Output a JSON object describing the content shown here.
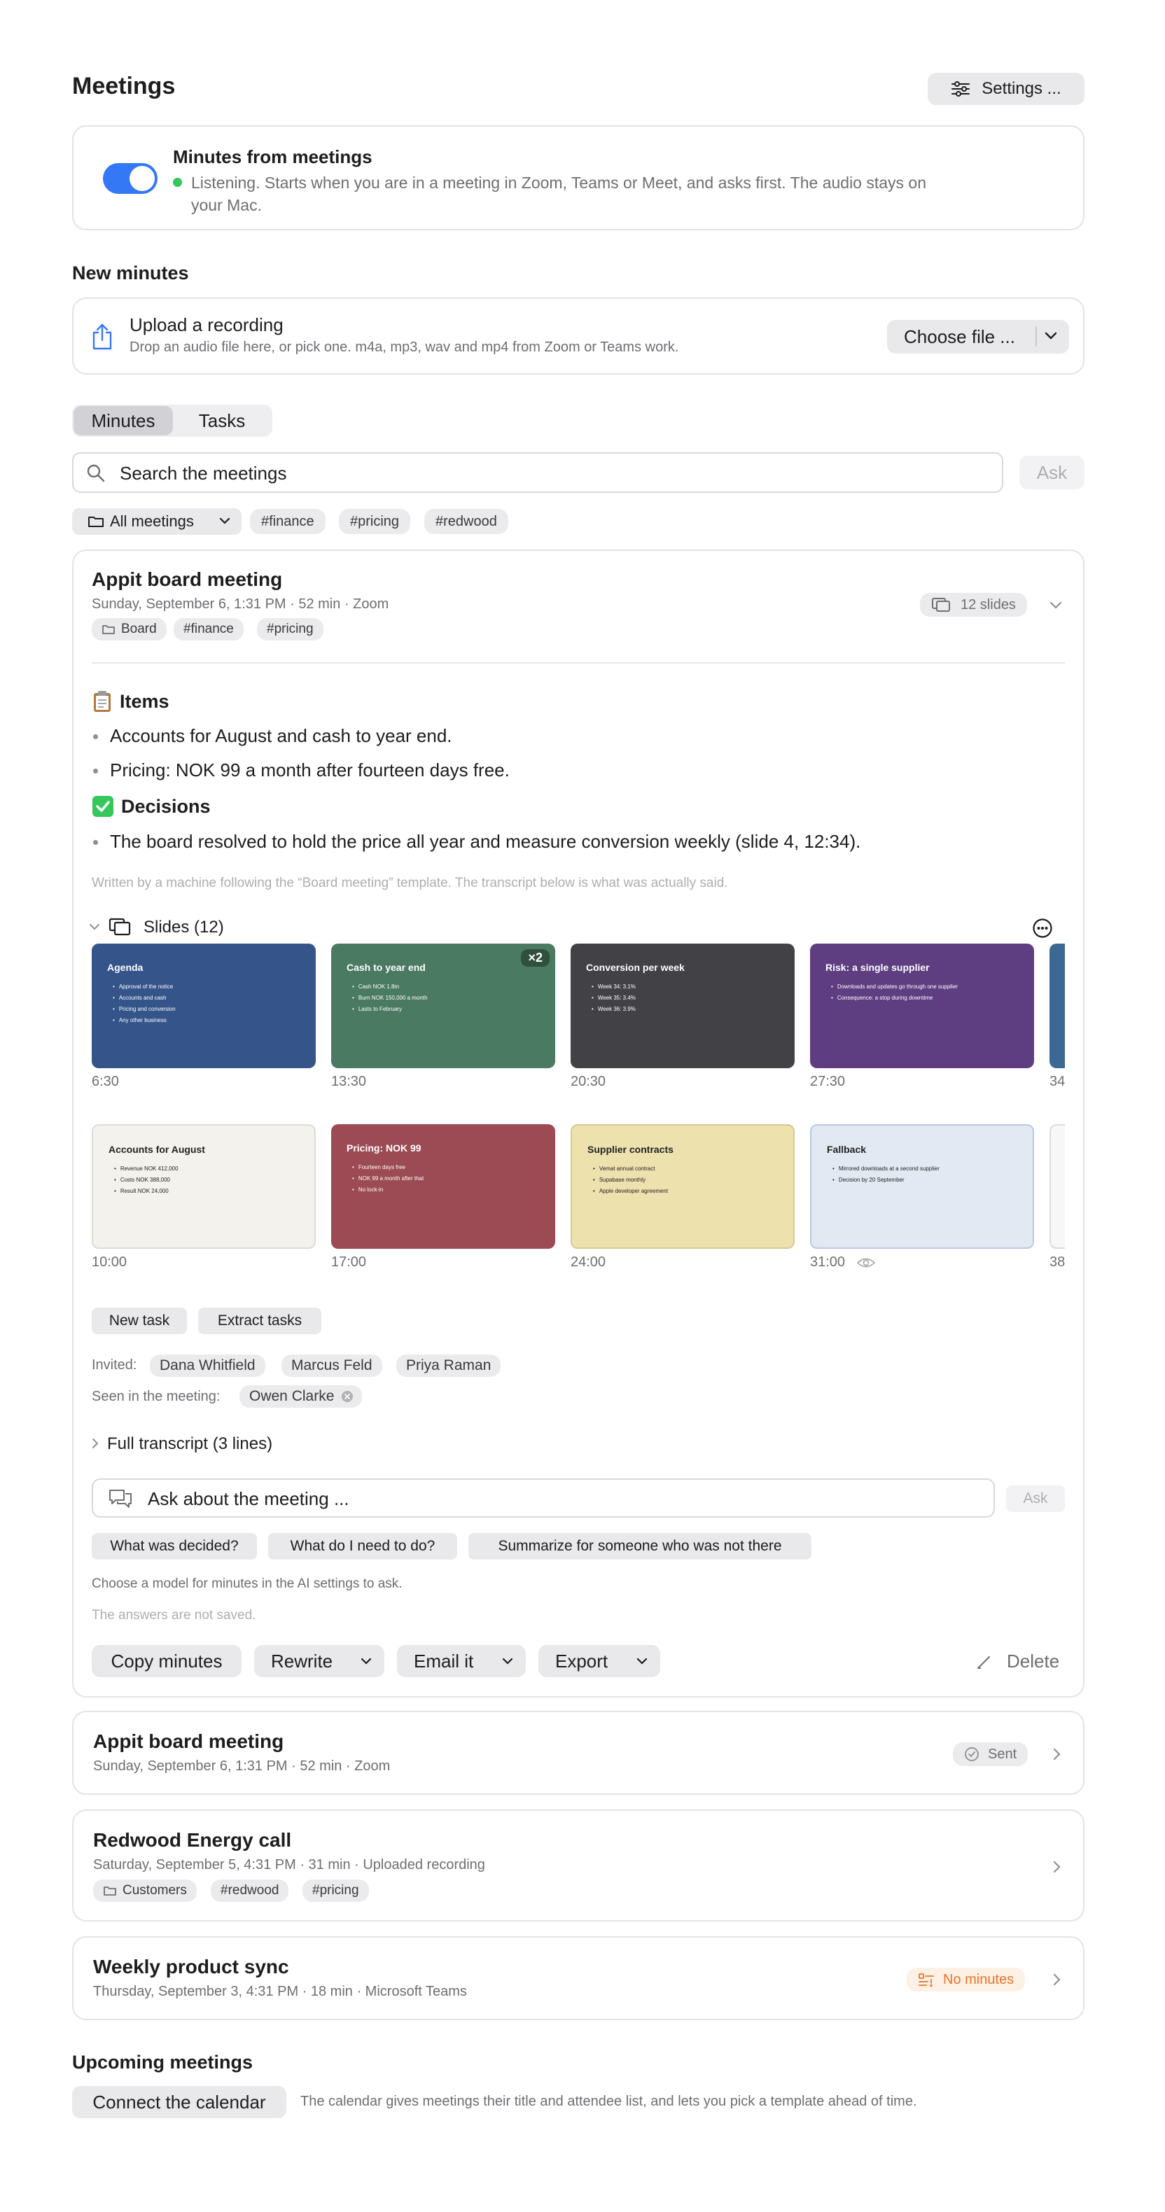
{
  "header": {
    "title": "Meetings",
    "settings_label": "Settings ..."
  },
  "minutes_toggle": {
    "title": "Minutes from meetings",
    "status": "Listening. Starts when you are in a meeting in Zoom, Teams or Meet, and asks first. The audio stays on",
    "status_line2": "your Mac.",
    "enabled": true
  },
  "new_minutes": {
    "heading": "New minutes",
    "upload_title": "Upload a recording",
    "upload_desc": "Drop an audio file here, or pick one. m4a, mp3, wav and mp4 from Zoom or Teams work.",
    "choose_label": "Choose file ..."
  },
  "tabs": [
    {
      "label": "Minutes",
      "active": true
    },
    {
      "label": "Tasks",
      "active": false
    }
  ],
  "search": {
    "placeholder": "Search the meetings",
    "ask_label": "Ask"
  },
  "filters": {
    "folder": "All meetings",
    "tags": [
      "#finance",
      "#pricing",
      "#redwood"
    ]
  },
  "expanded_meeting": {
    "title": "Appit board meeting",
    "meta": "Sunday, September 6, 1:31 PM · 52 min · Zoom",
    "slides_badge": "12 slides",
    "tags": [
      "Board",
      "#finance",
      "#pricing"
    ],
    "items_heading": "Items",
    "items": [
      "Accounts for August and cash to year end.",
      "Pricing: NOK 99 a month after fourteen days free."
    ],
    "decisions_heading": "Decisions",
    "decisions": [
      "The board resolved to hold the price all year and measure conversion weekly (slide 4, 12:34)."
    ],
    "template_note": "Written by a machine following the “Board meeting” template. The transcript below is what was actually said.",
    "slides_heading": "Slides (12)",
    "slides_row1": [
      {
        "title": "Agenda",
        "bullets": [
          "Approval of the notice",
          "Accounts and cash",
          "Pricing and conversion",
          "Any other business"
        ],
        "time": "6:30",
        "bg": "#34548a",
        "fg": "#ffffff"
      },
      {
        "title": "Cash to year end",
        "bullets": [
          "Cash NOK 1.8m",
          "Burn NOK 150,000 a month",
          "Lasts to February"
        ],
        "time": "13:30",
        "bg": "#4a7a62",
        "fg": "#ffffff",
        "badge": "×2"
      },
      {
        "title": "Conversion per week",
        "bullets": [
          "Week 34: 3.1%",
          "Week 35: 3.4%",
          "Week 36: 3.9%"
        ],
        "time": "20:30",
        "bg": "#424246",
        "fg": "#ffffff"
      },
      {
        "title": "Risk: a single supplier",
        "bullets": [
          "Downloads and updates go through one supplier",
          "Consequence: a stop during downtime"
        ],
        "time": "27:30",
        "bg": "#5e3d80",
        "fg": "#ffffff"
      },
      {
        "title": "",
        "bullets": [],
        "time": "34",
        "bg": "#3a6a94",
        "fg": "#ffffff"
      }
    ],
    "slides_row2": [
      {
        "title": "Accounts for August",
        "bullets": [
          "Revenue NOK 412,000",
          "Costs NOK 388,000",
          "Result NOK 24,000"
        ],
        "time": "10:00",
        "bg": "#f4f2ec",
        "fg": "#222222"
      },
      {
        "title": "Pricing: NOK 99",
        "bullets": [
          "Fourteen days free",
          "NOK 99 a month after that",
          "No lock-in"
        ],
        "time": "17:00",
        "bg": "#9c4b54",
        "fg": "#ffffff"
      },
      {
        "title": "Supplier contracts",
        "bullets": [
          "Vemat annual contract",
          "Supabase monthly",
          "Apple developer agreement"
        ],
        "time": "24:00",
        "bg": "#ede1ad",
        "fg": "#222222"
      },
      {
        "title": "Fallback",
        "bullets": [
          "Mirrored downloads at a second supplier",
          "Decision by 20 September"
        ],
        "time": "31:00",
        "bg": "#e2e9f3",
        "fg": "#222222"
      },
      {
        "title": "",
        "bullets": [],
        "time": "38",
        "bg": "#f7f7f7",
        "fg": "#222222"
      }
    ],
    "task_buttons": [
      "New task",
      "Extract tasks"
    ],
    "invited_label": "Invited:",
    "invited": [
      "Dana Whitfield",
      "Marcus Feld",
      "Priya Raman"
    ],
    "seen_label": "Seen in the meeting:",
    "seen": [
      "Owen Clarke"
    ],
    "transcript_label": "Full transcript (3 lines)",
    "ask_placeholder": "Ask about the meeting ...",
    "ask_label": "Ask",
    "suggestions": [
      "What was decided?",
      "What do I need to do?",
      "Summarize for someone who was not there"
    ],
    "model_note": "Choose a model for minutes in the AI settings to ask.",
    "answers_note": "The answers are not saved.",
    "actions": {
      "copy": "Copy minutes",
      "rewrite": "Rewrite",
      "email": "Email it",
      "export": "Export",
      "delete": "Delete"
    }
  },
  "meetings": [
    {
      "title": "Appit board meeting",
      "meta": "Sunday, September 6, 1:31 PM · 52 min · Zoom",
      "status": "Sent"
    },
    {
      "title": "Redwood Energy call",
      "meta": "Saturday, September 5, 4:31 PM · 31 min · Uploaded recording",
      "tags": [
        "Customers",
        "#redwood",
        "#pricing"
      ]
    },
    {
      "title": "Weekly product sync",
      "meta": "Thursday, September 3, 4:31 PM · 18 min · Microsoft Teams",
      "status": "No minutes"
    }
  ],
  "upcoming": {
    "heading": "Upcoming meetings",
    "connect_label": "Connect the calendar",
    "note": "The calendar gives meetings their title and attendee list, and lets you pick a template ahead of time."
  },
  "colors": {
    "accent": "#3478f6",
    "listening": "#34c759",
    "warning": "#e8762a",
    "warning_bg": "#fdf0e4"
  }
}
